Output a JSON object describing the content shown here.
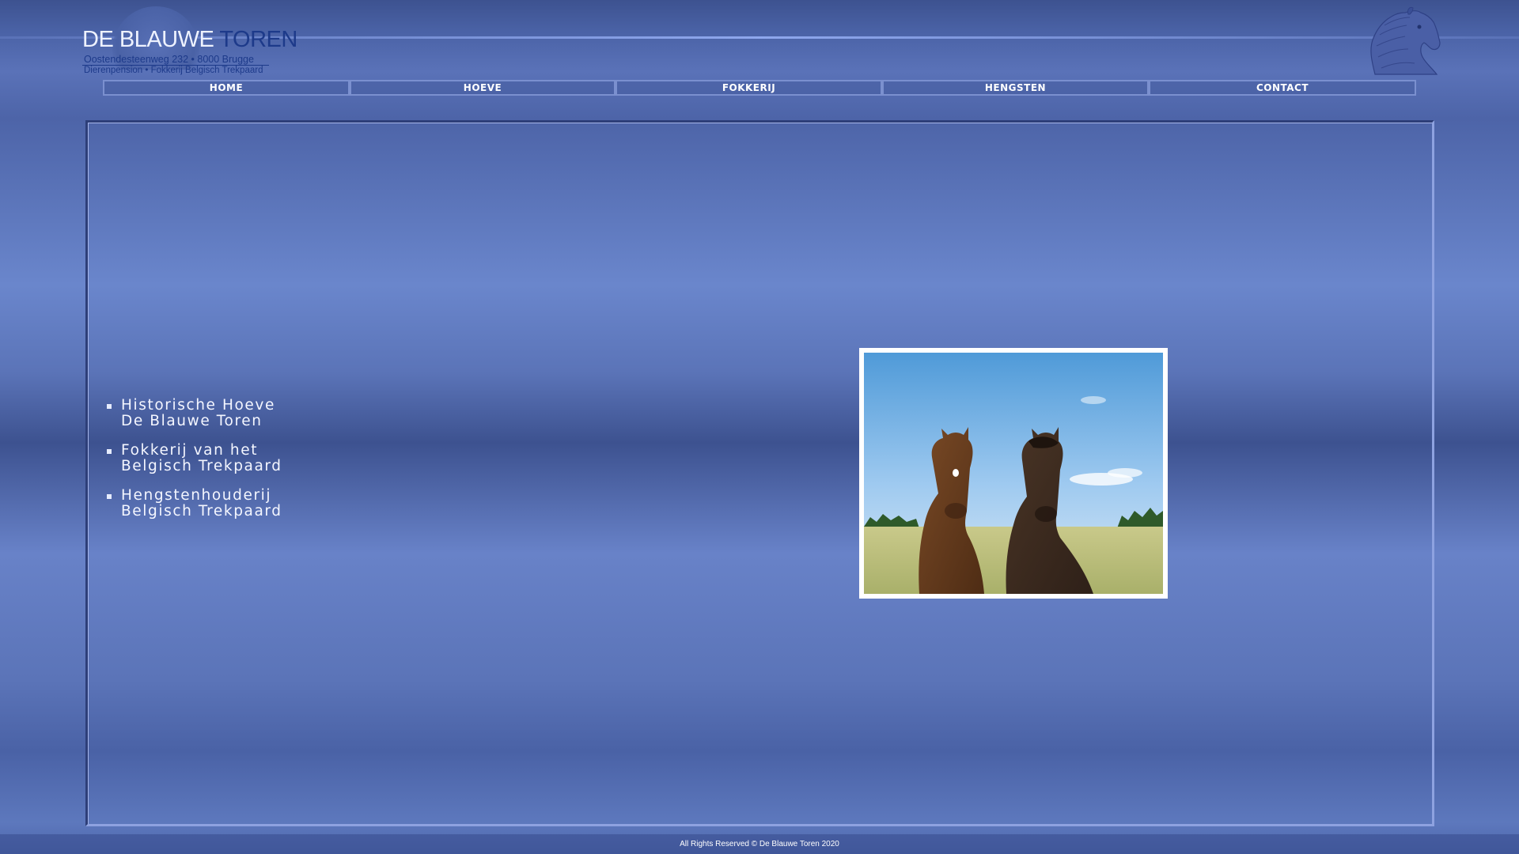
{
  "logo": {
    "name_part1": "DE BLAUWE ",
    "name_part2": "TOREN",
    "address": "Oostendesteenweg 232 • 8000 Brugge",
    "tagline": "Dierenpension • Fokkerij Belgisch Trekpaard"
  },
  "nav": {
    "items": [
      {
        "label": "HOME"
      },
      {
        "label": "HOEVE"
      },
      {
        "label": "FOKKERIJ"
      },
      {
        "label": "HENGSTEN"
      },
      {
        "label": "CONTACT"
      }
    ]
  },
  "intro": {
    "items": [
      {
        "line1": "Historische Hoeve",
        "line2": "De Blauwe Toren"
      },
      {
        "line1": "Fokkerij van het",
        "line2": "Belgisch Trekpaard"
      },
      {
        "line1": "Hengstenhouderij",
        "line2": "Belgisch Trekpaard"
      }
    ]
  },
  "photo": {
    "subject": "two-horses-photo"
  },
  "footer": {
    "text": "All Rights Reserved © De Blauwe Toren 2020"
  },
  "colors": {
    "background": "#5a72b8",
    "logo_dark_blue": "#1d3a8a",
    "nav_border": "#7b90cf",
    "text_light": "#f4f6ff"
  }
}
